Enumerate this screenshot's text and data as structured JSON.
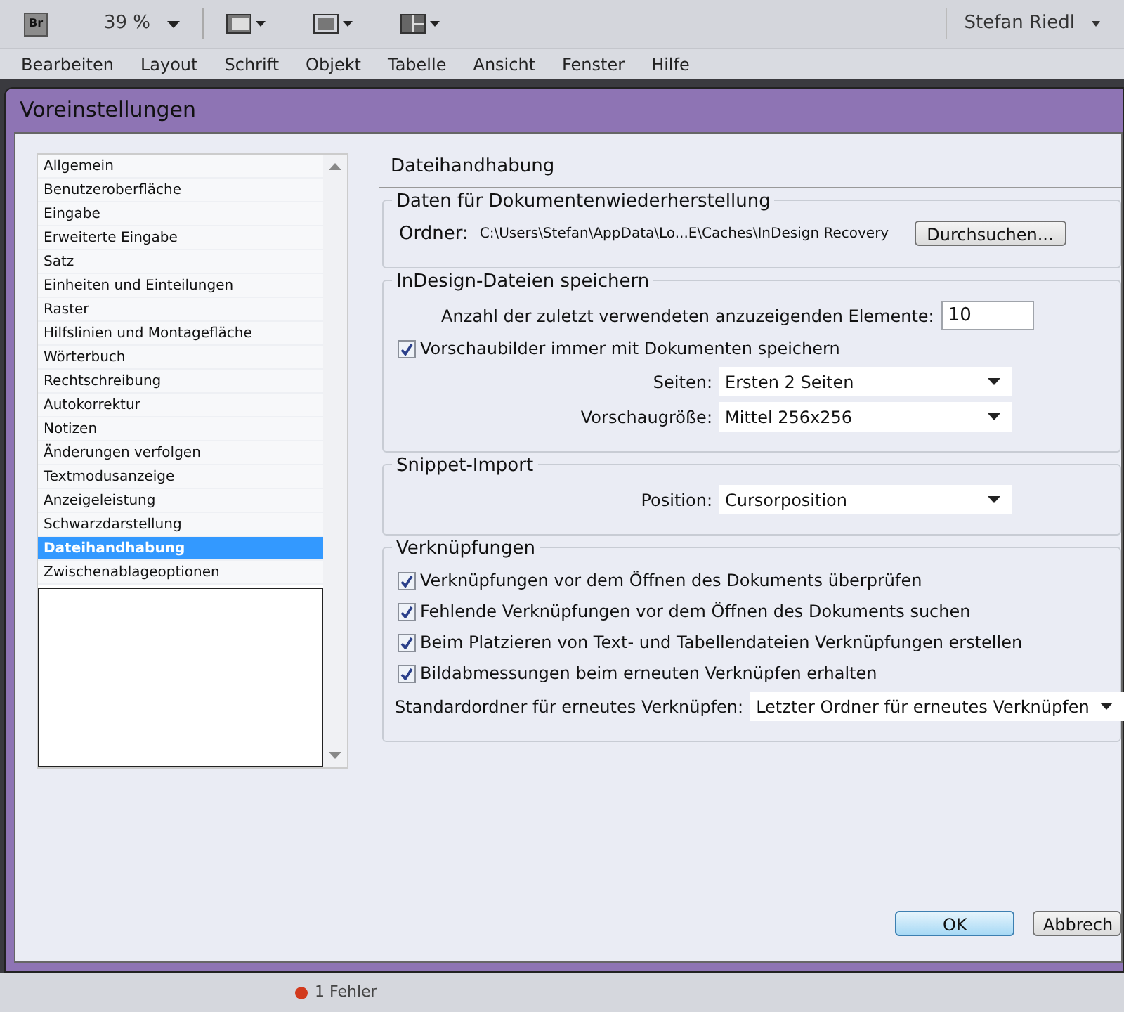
{
  "toolbar": {
    "bridge": "Br",
    "zoom": "39 %",
    "user": "Stefan Riedl"
  },
  "menu": [
    "Bearbeiten",
    "Layout",
    "Schrift",
    "Objekt",
    "Tabelle",
    "Ansicht",
    "Fenster",
    "Hilfe"
  ],
  "dialog": {
    "title": "Voreinstellungen",
    "sidebar": {
      "items": [
        {
          "label": "Allgemein",
          "selected": false
        },
        {
          "label": "Benutzeroberfläche",
          "selected": false
        },
        {
          "label": "Eingabe",
          "selected": false
        },
        {
          "label": "Erweiterte Eingabe",
          "selected": false
        },
        {
          "label": "Satz",
          "selected": false
        },
        {
          "label": "Einheiten und Einteilungen",
          "selected": false
        },
        {
          "label": "Raster",
          "selected": false
        },
        {
          "label": "Hilfslinien und Montagefläche",
          "selected": false
        },
        {
          "label": "Wörterbuch",
          "selected": false
        },
        {
          "label": "Rechtschreibung",
          "selected": false
        },
        {
          "label": "Autokorrektur",
          "selected": false
        },
        {
          "label": "Notizen",
          "selected": false
        },
        {
          "label": "Änderungen verfolgen",
          "selected": false
        },
        {
          "label": "Textmodusanzeige",
          "selected": false
        },
        {
          "label": "Anzeigeleistung",
          "selected": false
        },
        {
          "label": "Schwarzdarstellung",
          "selected": false
        },
        {
          "label": "Dateihandhabung",
          "selected": true
        },
        {
          "label": "Zwischenablageoptionen",
          "selected": false
        }
      ]
    },
    "heading": "Dateihandhabung",
    "sections": [
      {
        "title": "Daten für Dokumentenwiederherstellung",
        "rows": [
          {
            "kind": "path",
            "label": "Ordner:",
            "value": "C:\\Users\\Stefan\\AppData\\Lo...E\\Caches\\InDesign Recovery",
            "button": "Durchsuchen..."
          }
        ]
      },
      {
        "title": "InDesign-Dateien speichern",
        "rows": [
          {
            "kind": "number",
            "label": "Anzahl der zuletzt verwendeten anzuzeigenden Elemente:",
            "value": "10"
          },
          {
            "kind": "checkbox",
            "label": "Vorschaubilder immer mit Dokumenten speichern",
            "checked": true
          },
          {
            "kind": "select",
            "label": "Seiten:",
            "value": "Ersten 2 Seiten"
          },
          {
            "kind": "select",
            "label": "Vorschaugröße:",
            "value": "Mittel 256x256"
          }
        ]
      },
      {
        "title": "Snippet-Import",
        "rows": [
          {
            "kind": "select",
            "label": "Position:",
            "value": "Cursorposition"
          }
        ]
      },
      {
        "title": "Verknüpfungen",
        "rows": [
          {
            "kind": "checkbox",
            "label": "Verknüpfungen vor dem Öffnen des Dokuments überprüfen",
            "checked": true
          },
          {
            "kind": "checkbox",
            "label": "Fehlende Verknüpfungen vor dem Öffnen des Dokuments suchen",
            "checked": true
          },
          {
            "kind": "checkbox",
            "label": "Beim Platzieren von Text- und Tabellendateien Verknüpfungen erstellen",
            "checked": true
          },
          {
            "kind": "checkbox",
            "label": "Bildabmessungen beim erneuten Verknüpfen erhalten",
            "checked": true
          },
          {
            "kind": "select",
            "label": "Standardordner für erneutes Verknüpfen:",
            "value": "Letzter Ordner für erneutes Verknüpfen"
          }
        ]
      }
    ],
    "buttons": [
      {
        "label": "OK",
        "default": true
      },
      {
        "label": "Abbrech",
        "default": false
      }
    ]
  },
  "status_bar": {
    "errors": "1 Fehler"
  }
}
